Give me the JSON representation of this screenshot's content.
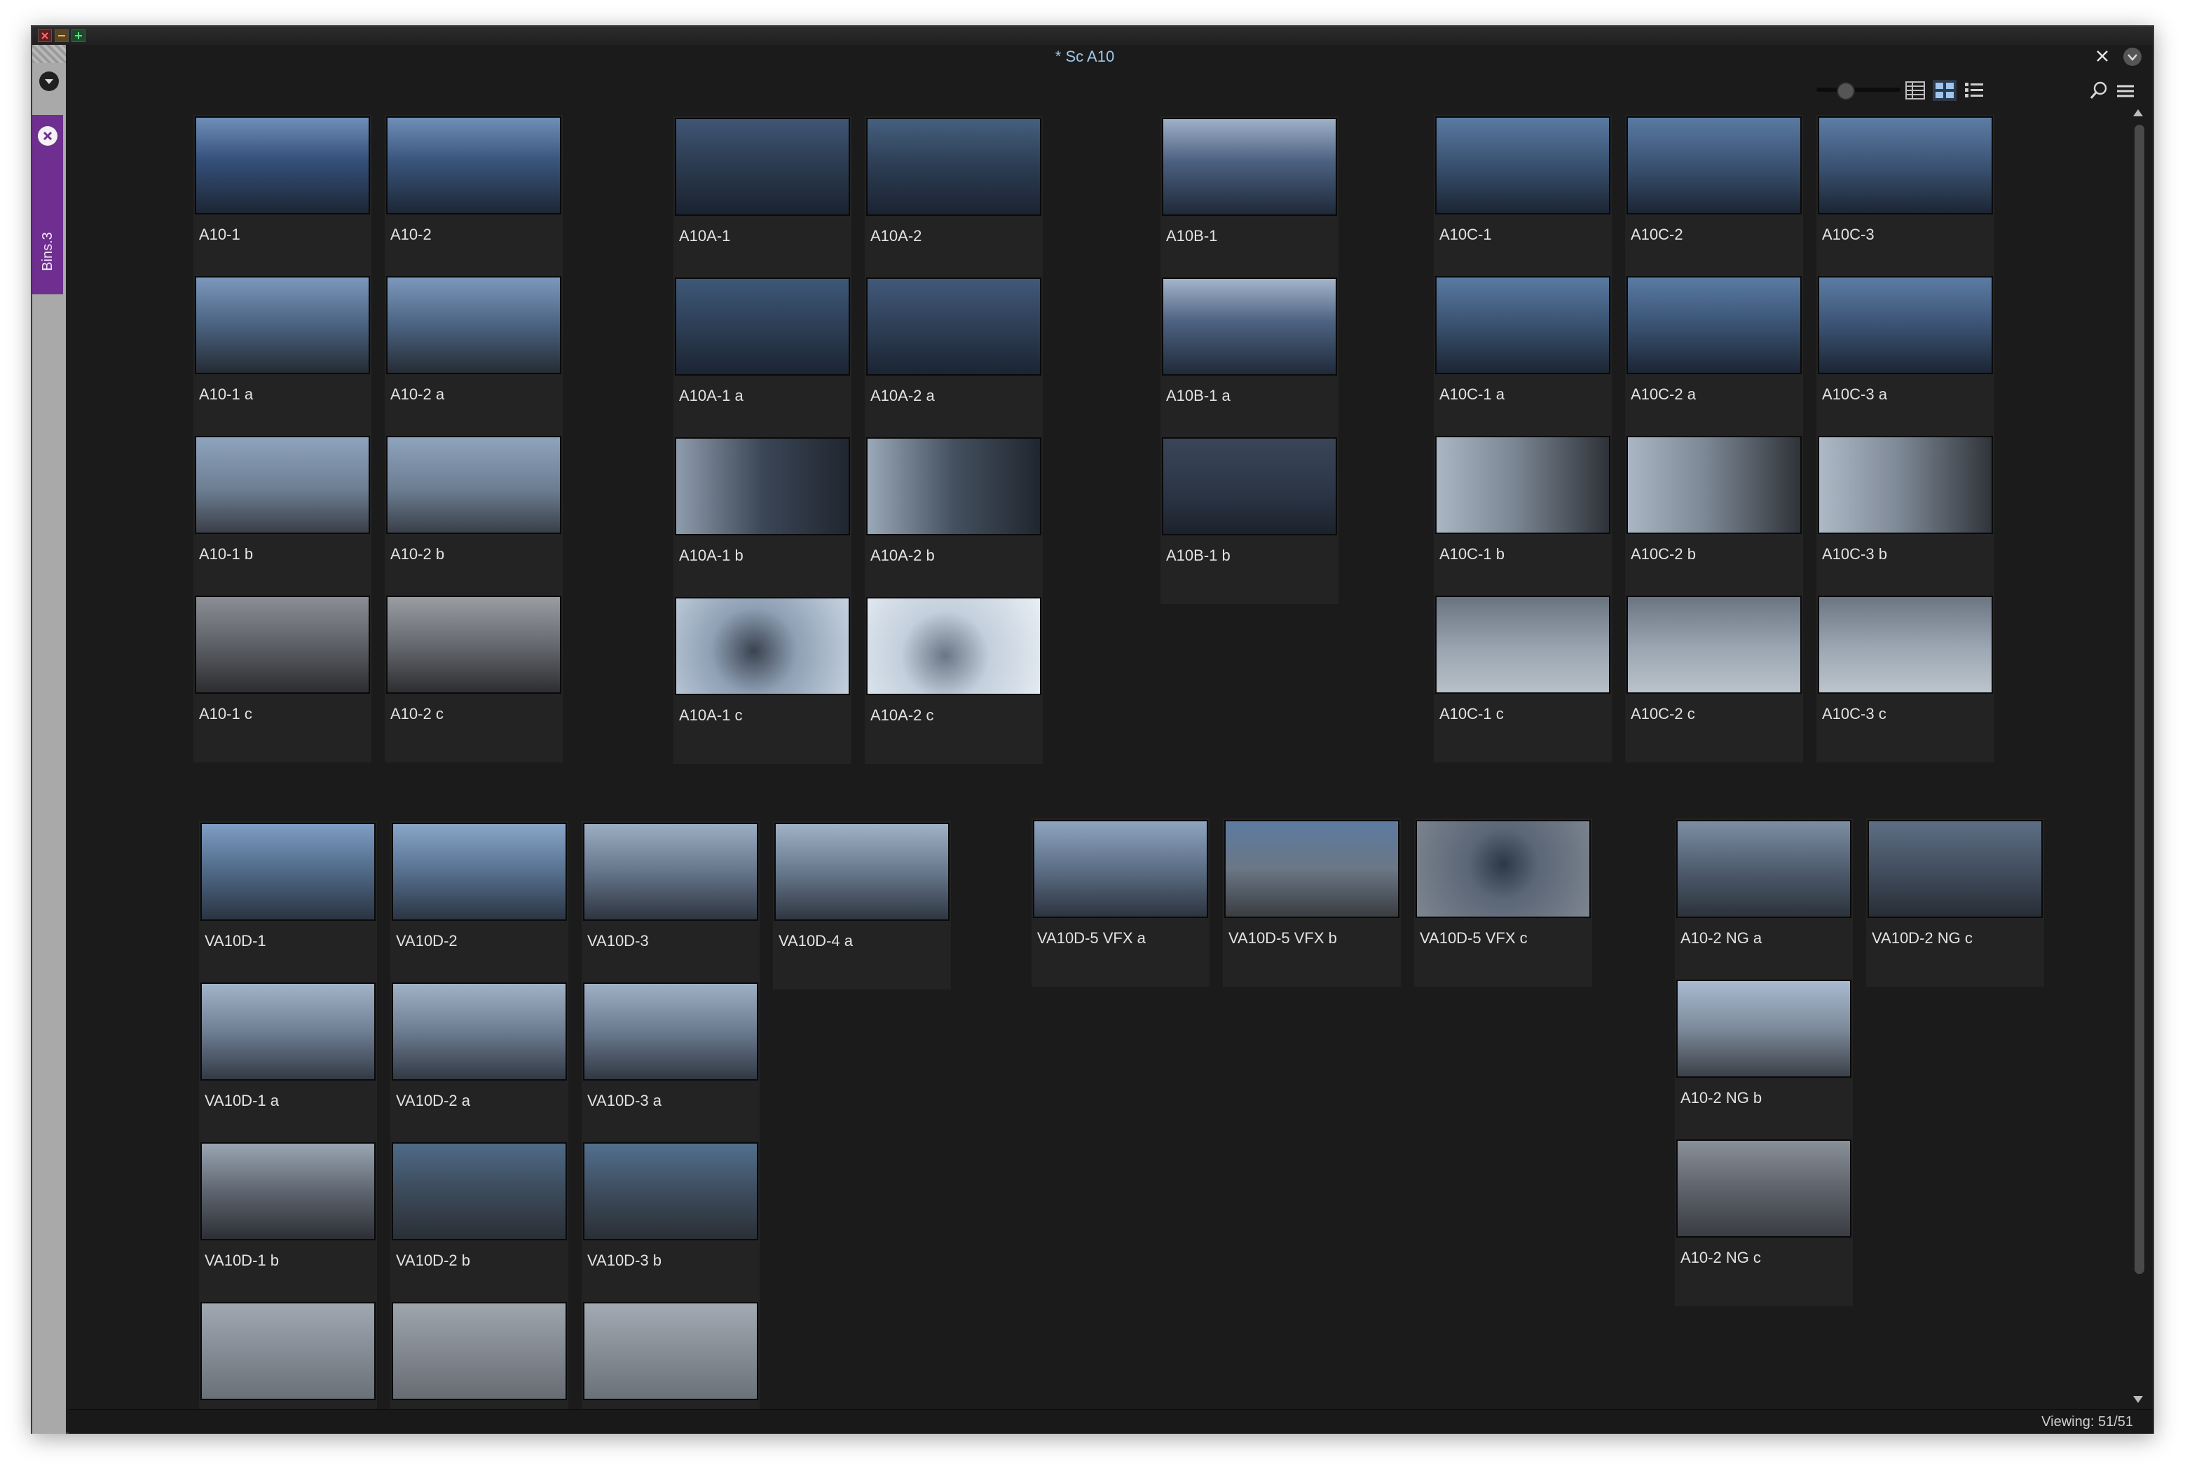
{
  "window": {
    "title": "* Sc A10",
    "bin_tab_label": "Bins.3"
  },
  "toolbar": {
    "zoom_level": 0.35,
    "view_modes": [
      "frame-view",
      "script-view",
      "list-view"
    ],
    "active_view": "script-view"
  },
  "clips": [
    {
      "name": "A10-1"
    },
    {
      "name": "A10-2"
    },
    {
      "name": "A10A-1"
    },
    {
      "name": "A10A-2"
    },
    {
      "name": "A10B-1"
    },
    {
      "name": "A10C-1"
    },
    {
      "name": "A10C-2"
    },
    {
      "name": "A10C-3"
    },
    {
      "name": "A10-1 a"
    },
    {
      "name": "A10-2 a"
    },
    {
      "name": "A10A-1 a"
    },
    {
      "name": "A10A-2 a"
    },
    {
      "name": "A10B-1 a"
    },
    {
      "name": "A10C-1 a"
    },
    {
      "name": "A10C-2 a"
    },
    {
      "name": "A10C-3 a"
    },
    {
      "name": "A10-1 b"
    },
    {
      "name": "A10-2 b"
    },
    {
      "name": "A10A-1 b"
    },
    {
      "name": "A10A-2 b"
    },
    {
      "name": "A10B-1 b"
    },
    {
      "name": "A10C-1 b"
    },
    {
      "name": "A10C-2 b"
    },
    {
      "name": "A10C-3 b"
    },
    {
      "name": "A10-1 c"
    },
    {
      "name": "A10-2 c"
    },
    {
      "name": "A10A-1 c"
    },
    {
      "name": "A10A-2 c"
    },
    {
      "name": "A10C-1 c"
    },
    {
      "name": "A10C-2 c"
    },
    {
      "name": "A10C-3 c"
    },
    {
      "name": "VA10D-1"
    },
    {
      "name": "VA10D-2"
    },
    {
      "name": "VA10D-3"
    },
    {
      "name": "VA10D-4 a"
    },
    {
      "name": "VA10D-5 VFX a"
    },
    {
      "name": "VA10D-5 VFX b"
    },
    {
      "name": "VA10D-5 VFX c"
    },
    {
      "name": "A10-2 NG a"
    },
    {
      "name": "VA10D-2 NG c"
    },
    {
      "name": "VA10D-1 a"
    },
    {
      "name": "VA10D-2 a"
    },
    {
      "name": "VA10D-3 a"
    },
    {
      "name": "A10-2 NG b"
    },
    {
      "name": "VA10D-1 b"
    },
    {
      "name": "VA10D-2 b"
    },
    {
      "name": "VA10D-3 b"
    },
    {
      "name": "A10-2 NG c"
    },
    {
      "name": ""
    },
    {
      "name": ""
    },
    {
      "name": ""
    }
  ],
  "status": {
    "viewing": "Viewing: 51/51"
  }
}
